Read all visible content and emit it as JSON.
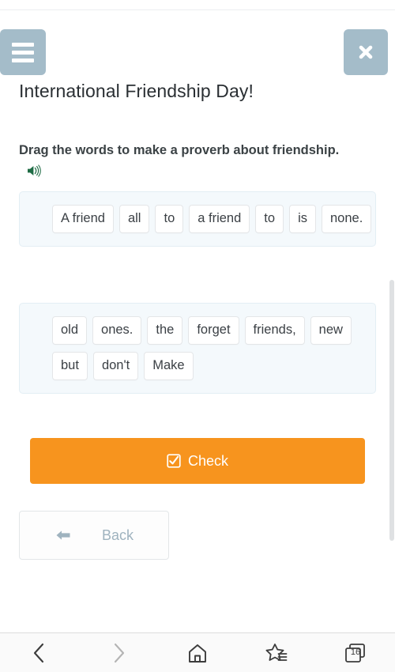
{
  "browser": {
    "bottom_nav": {
      "back_icon": "chevron-left-icon",
      "forward_icon": "chevron-right-icon",
      "home_icon": "home-icon",
      "bookmarks_icon": "star-lines-icon",
      "tabs_icon": "tabs-stack-icon",
      "tab_count": "16"
    }
  },
  "header": {
    "menu_icon": "hamburger-menu-icon",
    "close_icon": "close-x-icon"
  },
  "page": {
    "title": "International Friendship Day!",
    "instruction": "Drag the words to make a proverb about friendship.",
    "speaker_icon": "speaker-sound-icon"
  },
  "answer_panel": {
    "words": [
      "A friend",
      "all",
      "to",
      "a friend",
      "to",
      "is",
      "none."
    ]
  },
  "bank_panel": {
    "words": [
      "old",
      "ones.",
      "the",
      "forget",
      "friends,",
      "new",
      "but",
      "don't",
      "Make"
    ]
  },
  "actions": {
    "check_label": "Check",
    "check_icon": "checkbox-checked-icon",
    "back_label": "Back",
    "back_icon": "arrow-left-icon"
  },
  "colors": {
    "accent_orange": "#f7941e",
    "header_button": "#a4bcc9",
    "panel_bg": "#f4f9fc",
    "speaker_green": "#1e6b44",
    "back_text": "#9fb3bf"
  }
}
